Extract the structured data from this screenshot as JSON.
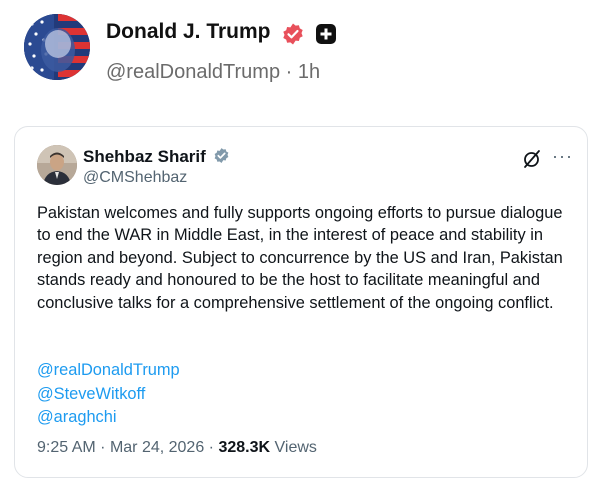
{
  "post": {
    "author_name": "Donald J. Trump",
    "handle": "@realDonaldTrump",
    "separator": "·",
    "age": "1h",
    "badge_color": "#e8505b"
  },
  "quoted": {
    "author_name": "Shehbaz Sharif",
    "handle": "@CMShehbaz",
    "verified_color": "#829aab",
    "more_label": "···",
    "text": "Pakistan welcomes and fully supports ongoing efforts to pursue dialogue to end the WAR in Middle East, in the interest of peace and stability in region and beyond. Subject to concurrence by the US and Iran, Pakistan stands ready and honoured to be the host to facilitate meaningful and conclusive talks for a comprehensive settlement of the ongoing conflict.",
    "mentions": [
      "@realDonaldTrump",
      "@SteveWitkoff",
      "@araghchi"
    ],
    "time": "9:25 AM",
    "date": "Mar 24, 2026",
    "views_count": "328.3K",
    "views_label": "Views",
    "link_color": "#1d9bf0"
  }
}
